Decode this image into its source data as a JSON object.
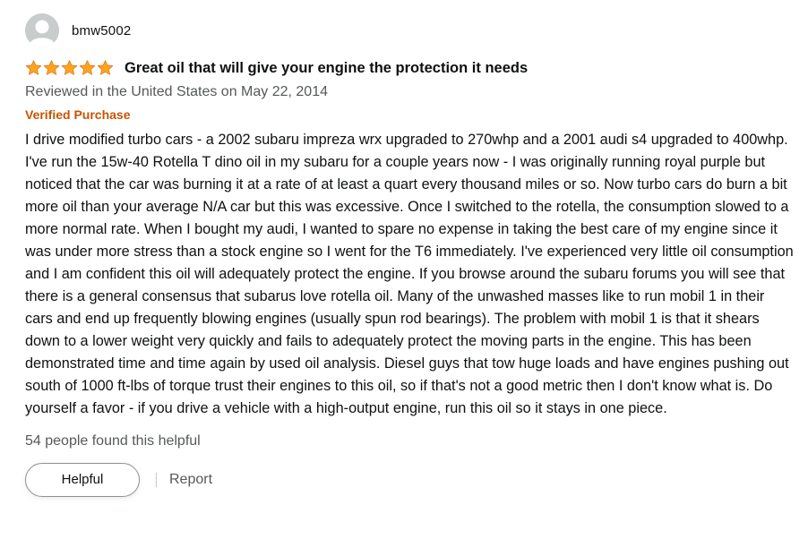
{
  "review": {
    "profile_name": "bmw5002",
    "rating": 5,
    "rating_max": 5,
    "title": "Great oil that will give your engine the protection it needs",
    "date_text": "Reviewed in the United States on May 22, 2014",
    "verified_label": "Verified Purchase",
    "body": "I drive modified turbo cars - a 2002 subaru impreza wrx upgraded to 270whp and a 2001 audi s4 upgraded to 400whp. I've run the 15w-40 Rotella T dino oil in my subaru for a couple years now - I was originally running royal purple but noticed that the car was burning it at a rate of at least a quart every thousand miles or so. Now turbo cars do burn a bit more oil than your average N/A car but this was excessive. Once I switched to the rotella, the consumption slowed to a more normal rate. When I bought my audi, I wanted to spare no expense in taking the best care of my engine since it was under more stress than a stock engine so I went for the T6 immediately. I've experienced very little oil consumption and I am confident this oil will adequately protect the engine. If you browse around the subaru forums you will see that there is a general consensus that subarus love rotella oil. Many of the unwashed masses like to run mobil 1 in their cars and end up frequently blowing engines (usually spun rod bearings). The problem with mobil 1 is that it shears down to a lower weight very quickly and fails to adequately protect the moving parts in the engine. This has been demonstrated time and time again by used oil analysis. Diesel guys that tow huge loads and have engines pushing out south of 1000 ft-lbs of torque trust their engines to this oil, so if that's not a good metric then I don't know what is. Do yourself a favor - if you drive a vehicle with a high-output engine, run this oil so it stays in one piece.",
    "helpful_text": "54 people found this helpful",
    "helpful_button_label": "Helpful",
    "report_label": "Report"
  },
  "icons": {
    "avatar": "default-avatar-icon",
    "star": "star-icon"
  },
  "colors": {
    "star": "#ffa41c",
    "verified": "#c45500",
    "secondary_text": "#565959",
    "primary_text": "#0f1111"
  }
}
